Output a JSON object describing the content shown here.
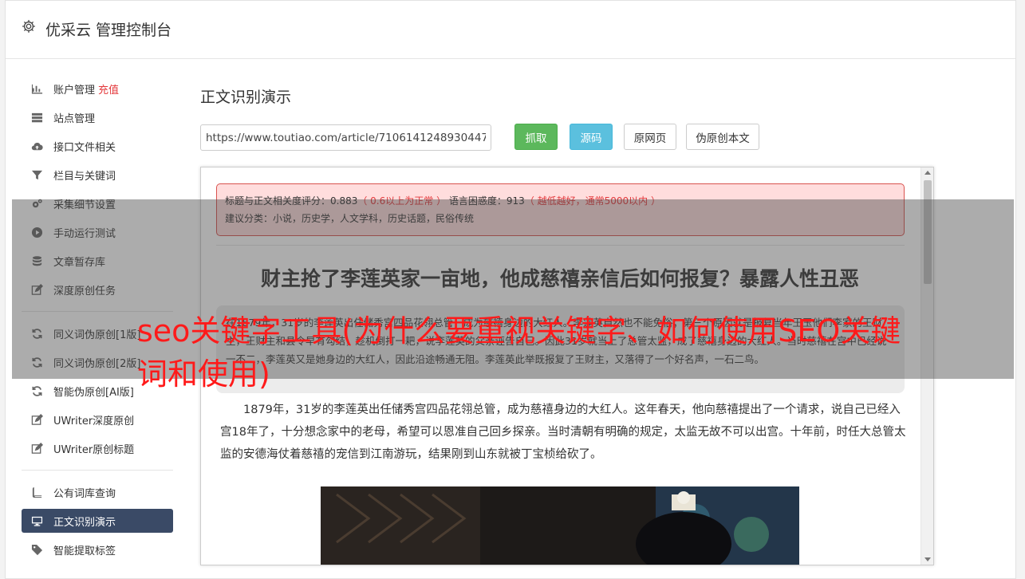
{
  "header": {
    "title": "优采云 管理控制台",
    "icon": "gear-icon"
  },
  "sidebar": {
    "groups": [
      [
        {
          "label": "账户管理",
          "badge": "充值",
          "icon": "bar-chart-icon"
        },
        {
          "label": "站点管理",
          "icon": "server-icon"
        },
        {
          "label": "接口文件相关",
          "icon": "cloud-upload-icon"
        },
        {
          "label": "栏目与关键词",
          "icon": "filter-icon"
        },
        {
          "label": "采集细节设置",
          "icon": "cogs-icon"
        },
        {
          "label": "手动运行测试",
          "icon": "play-circle-icon"
        },
        {
          "label": "文章暂存库",
          "icon": "database-icon"
        },
        {
          "label": "深度原创任务",
          "icon": "edit-icon"
        }
      ],
      [
        {
          "label": "同义词伪原创[1版]",
          "icon": "refresh-icon"
        },
        {
          "label": "同义词伪原创[2版]",
          "icon": "refresh-icon"
        },
        {
          "label": "智能伪原创[AI版]",
          "icon": "refresh-icon"
        },
        {
          "label": "UWriter深度原创",
          "icon": "edit-icon"
        },
        {
          "label": "UWriter原创标题",
          "icon": "edit-icon"
        }
      ],
      [
        {
          "label": "公有词库查询",
          "icon": "book-icon"
        },
        {
          "label": "正文识别演示",
          "icon": "desktop-icon",
          "active": true
        },
        {
          "label": "智能提取标签",
          "icon": "tag-icon"
        }
      ]
    ]
  },
  "main": {
    "title": "正文识别演示",
    "url_value": "https://www.toutiao.com/article/7106141248930447",
    "buttons": {
      "grab": "抓取",
      "source": "源码",
      "original": "原网页",
      "rewrite": "伪原创本文"
    }
  },
  "viewer": {
    "alert": {
      "line1_prefix": "标题与正文相关度评分：0.883",
      "line1_note1": "（ 0.6以上为正常 ）",
      "line1_mid": " 语言困惑度：913",
      "line1_note2": "（ 越低越好，通常5000以内 ）",
      "line2": "建议分类：小说，历史学，人文学科，历史话题，民俗传统"
    },
    "article_title": "财主抢了李莲英家一亩地，他成慈禧亲信后如何报复？暴露人性丑恶",
    "quote": "在1879年，31岁的李莲英出任储秀宫四品花翎总管，成为慈禧身边的大红人。”李莲英自然也不能免俗；第三个原因就是报复当年王玉他们李家的王财主，王财主和县令早有勾结，趁机倒打一耙，说李莲英的父亲诬告自己。因此31岁就当上了总管太监，成了慈禧身边的大红人。当时慈禧在宫中已经说一不二，李莲英又是她身边的大红人，因此沿途畅通无阻。李莲英此举既报复了王财主，又落得了一个好名声，一石二鸟。",
    "paragraph": "1879年，31岁的李莲英出任储秀宫四品花翎总管，成为慈禧身边的大红人。这年春天，他向慈禧提出了一个请求，说自己已经入宫18年了，十分想念家中的老母，希望可以恩准自己回乡探亲。当时清朝有明确的规定，太监无故不可以出宫。十年前，时任大总管太监的安德海仗着慈禧的宠信到江南游玩，结果刚到山东就被丁宝桢给砍了。"
  },
  "overlay": {
    "text": "seo关键字工具(为什么要重视关键字、如何使用SEO关键词和使用)"
  }
}
